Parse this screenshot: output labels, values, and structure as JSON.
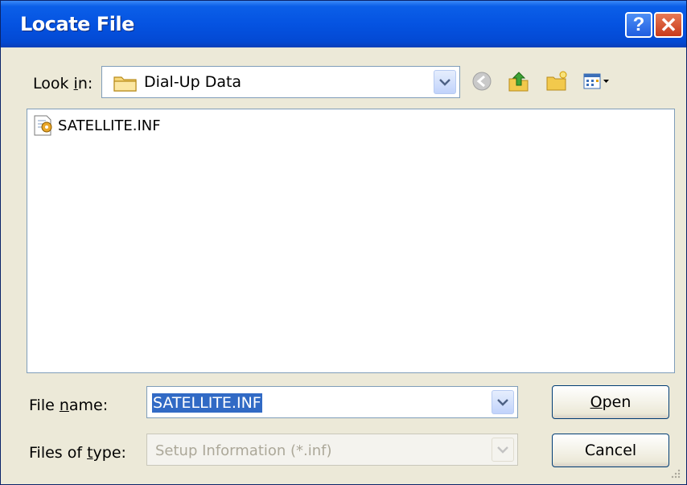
{
  "window": {
    "title": "Locate File"
  },
  "title_buttons": {
    "help": "?",
    "close": "✕"
  },
  "look_in": {
    "label_pre": "Look ",
    "label_key": "i",
    "label_post": "n:",
    "value": "Dial-Up Data",
    "folder_icon": "folder-icon"
  },
  "nav_icons": [
    "back-icon",
    "up-folder-icon",
    "new-folder-icon",
    "view-menu-icon"
  ],
  "files": [
    {
      "name": "SATELLITE.INF",
      "icon": "setup-file-icon"
    }
  ],
  "file_name": {
    "label_pre": "File ",
    "label_key": "n",
    "label_post": "ame:",
    "value": "SATELLITE.INF"
  },
  "file_type": {
    "label_pre": "Files of ",
    "label_key": "t",
    "label_post": "ype:",
    "value": "Setup Information (*.inf)"
  },
  "buttons": {
    "open_key": "O",
    "open_rest": "pen",
    "cancel": "Cancel"
  },
  "colors": {
    "titlebar": "#0553e1",
    "selection": "#316ac5",
    "dialog_bg": "#ece9d8"
  }
}
